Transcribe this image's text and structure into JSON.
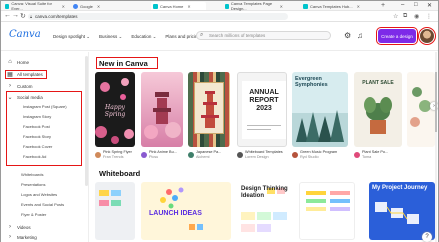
{
  "browser": {
    "tabs": [
      {
        "label": "Canva: Visual Suite for Ever...",
        "color": "#00c4cc"
      },
      {
        "label": "Google",
        "color": "#4285f4"
      },
      {
        "label": "Canva Home",
        "color": "#00c4cc"
      },
      {
        "label": "Canva Templates Page Design...",
        "color": "#00c4cc"
      },
      {
        "label": "Canva Templates Hub...",
        "color": "#00c4cc"
      }
    ],
    "url": "canva.com/templates",
    "controls": {
      "minimize": "–",
      "maximize": "□",
      "close": "✕"
    }
  },
  "header": {
    "logo": "Canva",
    "nav": [
      "Design spotlight ⌄",
      "Business ⌄",
      "Education ⌄",
      "Plans and pricing ⌄",
      "Learn ⌄"
    ],
    "search_placeholder": "Search millions of templates",
    "create_label": "Create a design"
  },
  "sidebar": {
    "home": "Home",
    "templates": "All templates",
    "top": [
      "Home",
      "All templates",
      "Custom"
    ],
    "social_media": "Social media",
    "sub_items": [
      "Instagram Post (Square)",
      "Instagram Story",
      "Facebook Post",
      "Facebook Story",
      "Facebook Cover",
      "Facebook Ad"
    ],
    "more": [
      "Whiteboards",
      "Presentations",
      "Logos and Websites",
      "Events and Social Posts",
      "Flyer & Poster",
      "Videos",
      "Marketing"
    ]
  },
  "main": {
    "new_title": "New in Canva",
    "whiteboard_title": "Whiteboard",
    "cards": [
      {
        "title": "Happy Spring",
        "author": "Pink Spring Flyer",
        "by": "Fran Trends"
      },
      {
        "title": "",
        "author": "Pink Anime Bu...",
        "by": "Picsu"
      },
      {
        "title": "",
        "author": "Japanese Pa...",
        "by": "Alchemi"
      },
      {
        "title": "ANNUAL REPORT 2023",
        "author": "Whiteboard Templates",
        "by": "Lorem Design"
      },
      {
        "title": "Evergreen Symphonies",
        "author": "Green Music Program",
        "by": "Ryd Studio"
      },
      {
        "title": "PLANT SALE",
        "author": "Plant Sale Po...",
        "by": "Toma"
      }
    ],
    "wb_cards": [
      "LAUNCH IDEAS",
      "Design Thinking Ideation",
      "My Project Journey"
    ],
    "help": "?"
  }
}
